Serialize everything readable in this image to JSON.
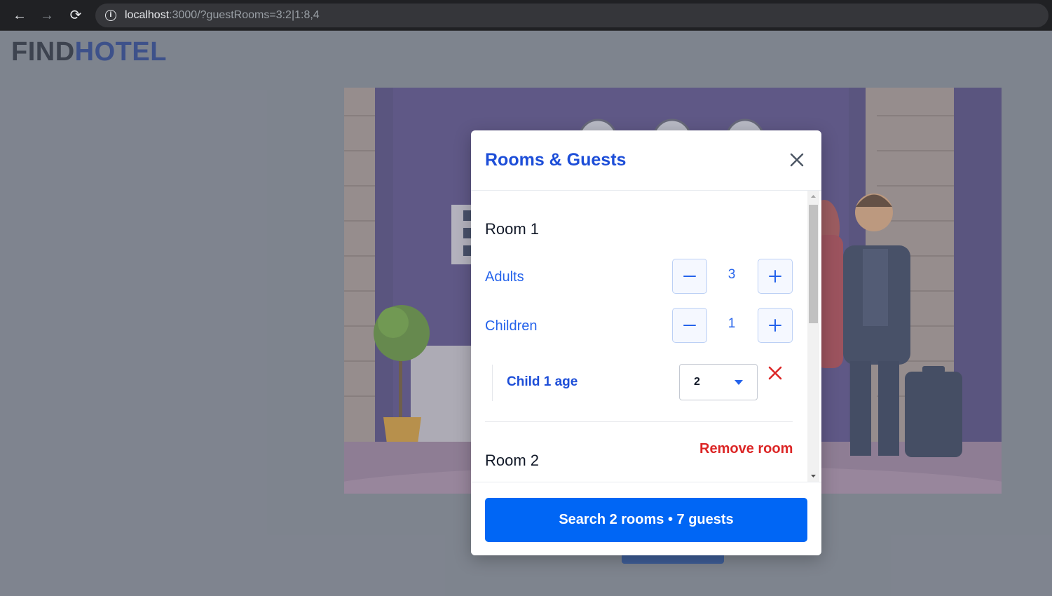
{
  "browser": {
    "back_icon": "←",
    "forward_icon": "→",
    "reload_icon": "⟳",
    "info_icon": "i",
    "url_host": "localhost",
    "url_rest": ":3000/?guestRooms=3:2|1:8,4"
  },
  "logo": {
    "part1": "FIND",
    "part2": "HOTEL"
  },
  "modal": {
    "title": "Rooms & Guests",
    "rooms": [
      {
        "title": "Room 1",
        "adults_label": "Adults",
        "adults_value": "3",
        "children_label": "Children",
        "children_value": "1",
        "child_age_label": "Child 1 age",
        "child_age_value": "2"
      },
      {
        "title": "Room 2",
        "remove_label": "Remove room"
      }
    ],
    "search_button": "Search 2 rooms • 7 guests"
  },
  "colors": {
    "accent": "#2563eb",
    "primary_button": "#0066f5",
    "danger": "#dc2626",
    "logo_dark": "#1e2430",
    "logo_blue": "#1e3a8a"
  }
}
